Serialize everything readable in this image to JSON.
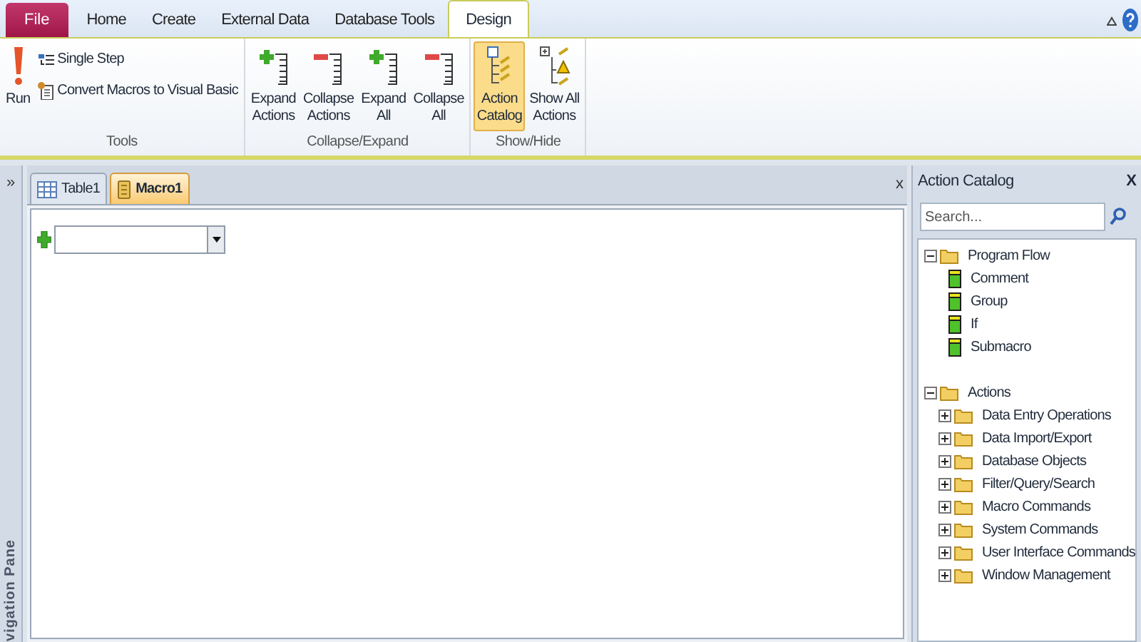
{
  "ribbon_tabs": [
    {
      "label": "File",
      "kind": "file",
      "selected": false
    },
    {
      "label": "Home",
      "kind": "tab",
      "selected": false
    },
    {
      "label": "Create",
      "kind": "tab",
      "selected": false
    },
    {
      "label": "External Data",
      "kind": "tab",
      "selected": false
    },
    {
      "label": "Database Tools",
      "kind": "tab",
      "selected": false
    },
    {
      "label": "Design",
      "kind": "tab",
      "selected": true
    }
  ],
  "ribbon_groups": [
    {
      "label": "Tools",
      "buttons": [
        {
          "kind": "large",
          "lines": [
            "Run"
          ],
          "selected": false
        },
        {
          "kind": "small",
          "lines": [
            "Single Step"
          ],
          "selected": false
        },
        {
          "kind": "small",
          "lines": [
            "Convert Macros to Visual Basic"
          ],
          "selected": false
        }
      ]
    },
    {
      "label": "Collapse/Expand",
      "buttons": [
        {
          "kind": "large",
          "lines": [
            "Expand",
            "Actions"
          ],
          "selected": false
        },
        {
          "kind": "large",
          "lines": [
            "Collapse",
            "Actions"
          ],
          "selected": false
        },
        {
          "kind": "large",
          "lines": [
            "Expand",
            "All"
          ],
          "selected": false
        },
        {
          "kind": "large",
          "lines": [
            "Collapse",
            "All"
          ],
          "selected": false
        }
      ]
    },
    {
      "label": "Show/Hide",
      "buttons": [
        {
          "kind": "large",
          "lines": [
            "Action",
            "Catalog"
          ],
          "selected": true
        },
        {
          "kind": "large",
          "lines": [
            "Show All",
            "Actions"
          ],
          "selected": false
        }
      ]
    }
  ],
  "navigation_pane": {
    "toggle": "»",
    "label": "vigation Pane"
  },
  "document_tabs": [
    {
      "label": "Table1",
      "kind": "table",
      "selected": false
    },
    {
      "label": "Macro1",
      "kind": "macro",
      "selected": true
    }
  ],
  "document_close": "x",
  "action_catalog": {
    "title": "Action Catalog",
    "close": "X",
    "search": {
      "placeholder": "Search..."
    },
    "tree": [
      {
        "label": "Program Flow",
        "expanded": true,
        "children": [
          {
            "label": "Comment"
          },
          {
            "label": "Group"
          },
          {
            "label": "If"
          },
          {
            "label": "Submacro"
          }
        ]
      },
      {
        "label": "Actions",
        "expanded": true,
        "children": [
          {
            "label": "Data Entry Operations",
            "expanded": false
          },
          {
            "label": "Data Import/Export",
            "expanded": false
          },
          {
            "label": "Database Objects",
            "expanded": false
          },
          {
            "label": "Filter/Query/Search",
            "expanded": false
          },
          {
            "label": "Macro Commands",
            "expanded": false
          },
          {
            "label": "System Commands",
            "expanded": false
          },
          {
            "label": "User Interface Commands",
            "expanded": false
          },
          {
            "label": "Window Management",
            "expanded": false
          }
        ]
      }
    ]
  }
}
